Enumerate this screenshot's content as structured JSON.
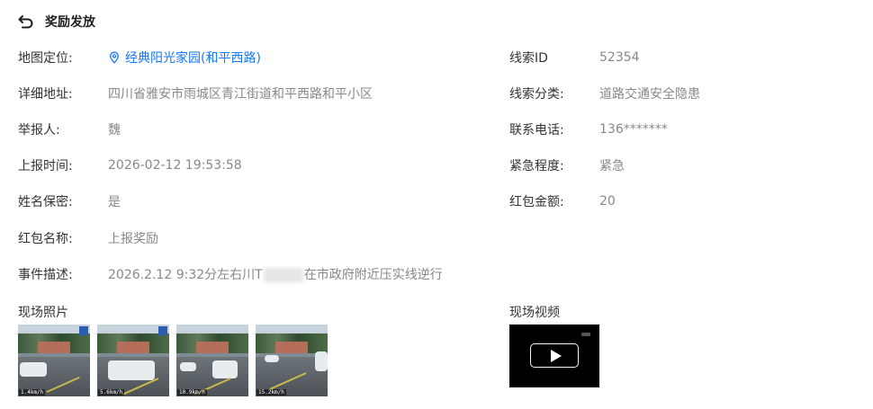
{
  "header": {
    "title": "奖励发放",
    "back_icon": "back-arrow-icon"
  },
  "left_fields": [
    {
      "label": "地图定位:",
      "value": "经典阳光家园(和平西路)"
    },
    {
      "label": "详细地址:",
      "value": "四川省雅安市雨城区青江街道和平西路和平小区"
    },
    {
      "label": "举报人:",
      "value": "魏"
    },
    {
      "label": "上报时间:",
      "value": "2026-02-12 19:53:58"
    },
    {
      "label": "姓名保密:",
      "value": "是"
    },
    {
      "label": "红包名称:",
      "value": "上报奖励"
    },
    {
      "label": "事件描述:",
      "value_prefix": "2026.2.12 9:32分左右川T",
      "value_suffix": "在市政府附近压实线逆行"
    }
  ],
  "right_fields": [
    {
      "label": "线索ID",
      "value": "52354"
    },
    {
      "label": "线索分类:",
      "value": "道路交通安全隐患"
    },
    {
      "label": "联系电话:",
      "value": "136*******"
    },
    {
      "label": "紧急程度:",
      "value": "紧急"
    },
    {
      "label": "红包金额:",
      "value": "20"
    }
  ],
  "photos_section": {
    "title": "现场照片",
    "photos": [
      {
        "stamp": "1.4km/h"
      },
      {
        "stamp": "5.6km/h"
      },
      {
        "stamp": "10.9km/h"
      },
      {
        "stamp": "15.2km/h"
      }
    ]
  },
  "video_section": {
    "title": "现场视频",
    "play_icon": "play-icon"
  },
  "colors": {
    "link": "#1677ff",
    "label": "#333333",
    "value": "#888888"
  }
}
